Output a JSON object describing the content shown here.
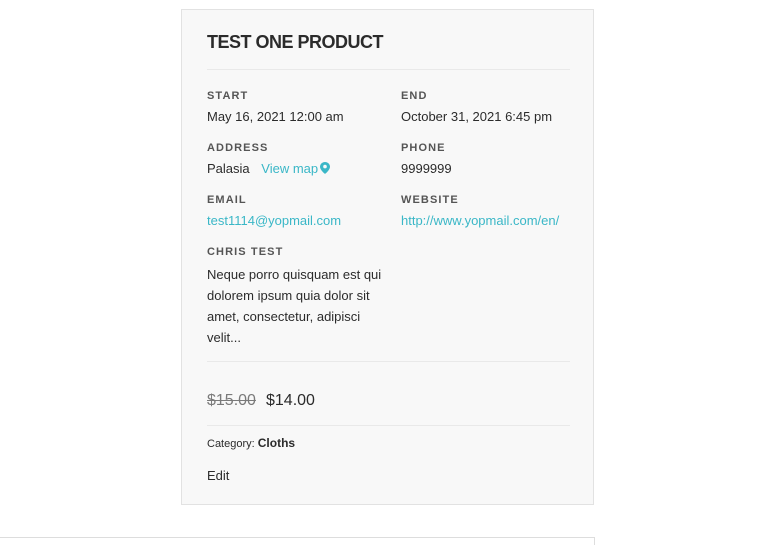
{
  "product": {
    "title": "TEST ONE PRODUCT",
    "start_label": "START",
    "start_value": "May 16, 2021 12:00 am",
    "end_label": "END",
    "end_value": "October 31, 2021 6:45 pm",
    "address_label": "ADDRESS",
    "address_value": "Palasia",
    "view_map_label": "View map",
    "phone_label": "PHONE",
    "phone_value": "9999999",
    "email_label": "EMAIL",
    "email_value": "test1114@yopmail.com",
    "website_label": "WEBSITE",
    "website_value": "http://www.yopmail.com/en/",
    "custom_label": "CHRIS TEST",
    "custom_value": "Neque porro quisquam est qui dolorem ipsum quia dolor sit amet, consectetur, adipisci velit...",
    "price_old": "$15.00",
    "price_new": "$14.00",
    "category_label": "Category:",
    "category_value": "Cloths",
    "edit_label": "Edit"
  },
  "colors": {
    "link": "#3ab7c7",
    "card_bg": "#f8f8f8",
    "border": "#e2e2e2"
  },
  "icons": {
    "map_pin": "map-pin-icon"
  }
}
